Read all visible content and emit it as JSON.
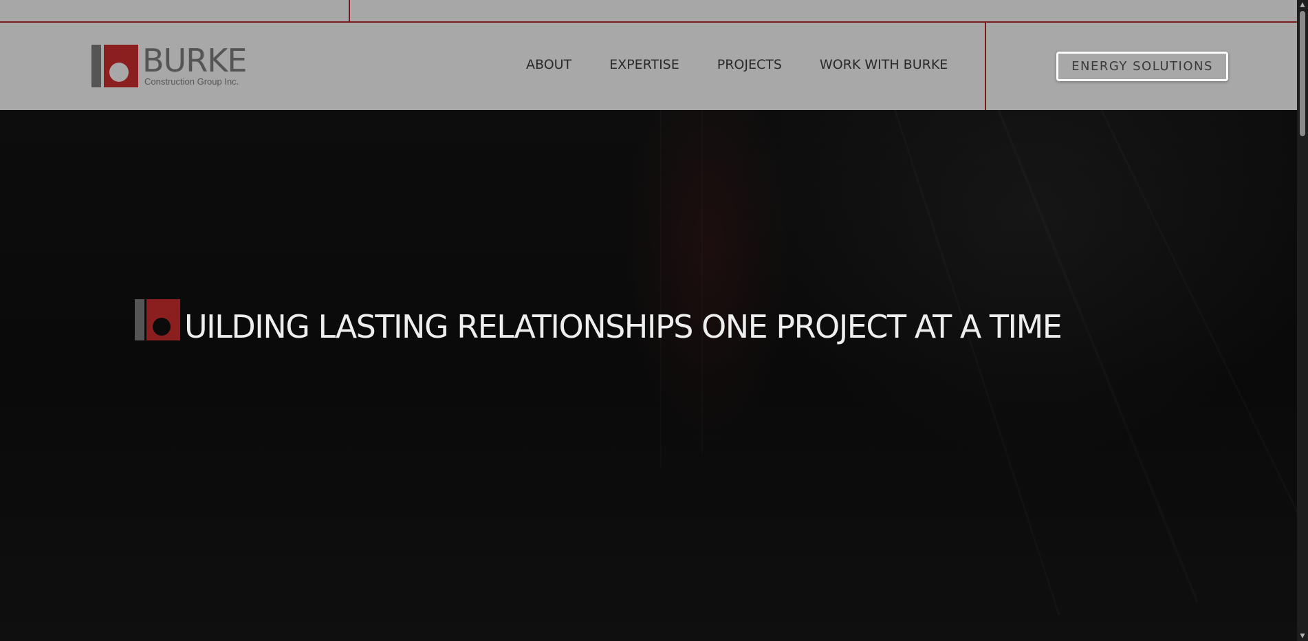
{
  "header": {
    "logo": {
      "wordmark": "BURKE",
      "subtitle": "Construction Group Inc."
    },
    "nav": [
      {
        "label": "ABOUT"
      },
      {
        "label": "EXPERTISE"
      },
      {
        "label": "PROJECTS"
      },
      {
        "label": "WORK WITH BURKE"
      }
    ],
    "cta_label": "ENERGY SOLUTIONS"
  },
  "hero": {
    "heading": "UILDING LASTING RELATIONSHIPS ONE PROJECT AT A TIME"
  },
  "colors": {
    "brand_red": "#8b1e1e",
    "brand_gray": "#555555",
    "header_bg": "#a8a8a8",
    "hero_bg": "#0b0b0b",
    "hero_text": "#eeeeee"
  },
  "icons": {
    "logo_mark": "burke-b-logo-mark",
    "scroll_up": "scroll-up-arrow",
    "scroll_down": "scroll-down-arrow"
  }
}
